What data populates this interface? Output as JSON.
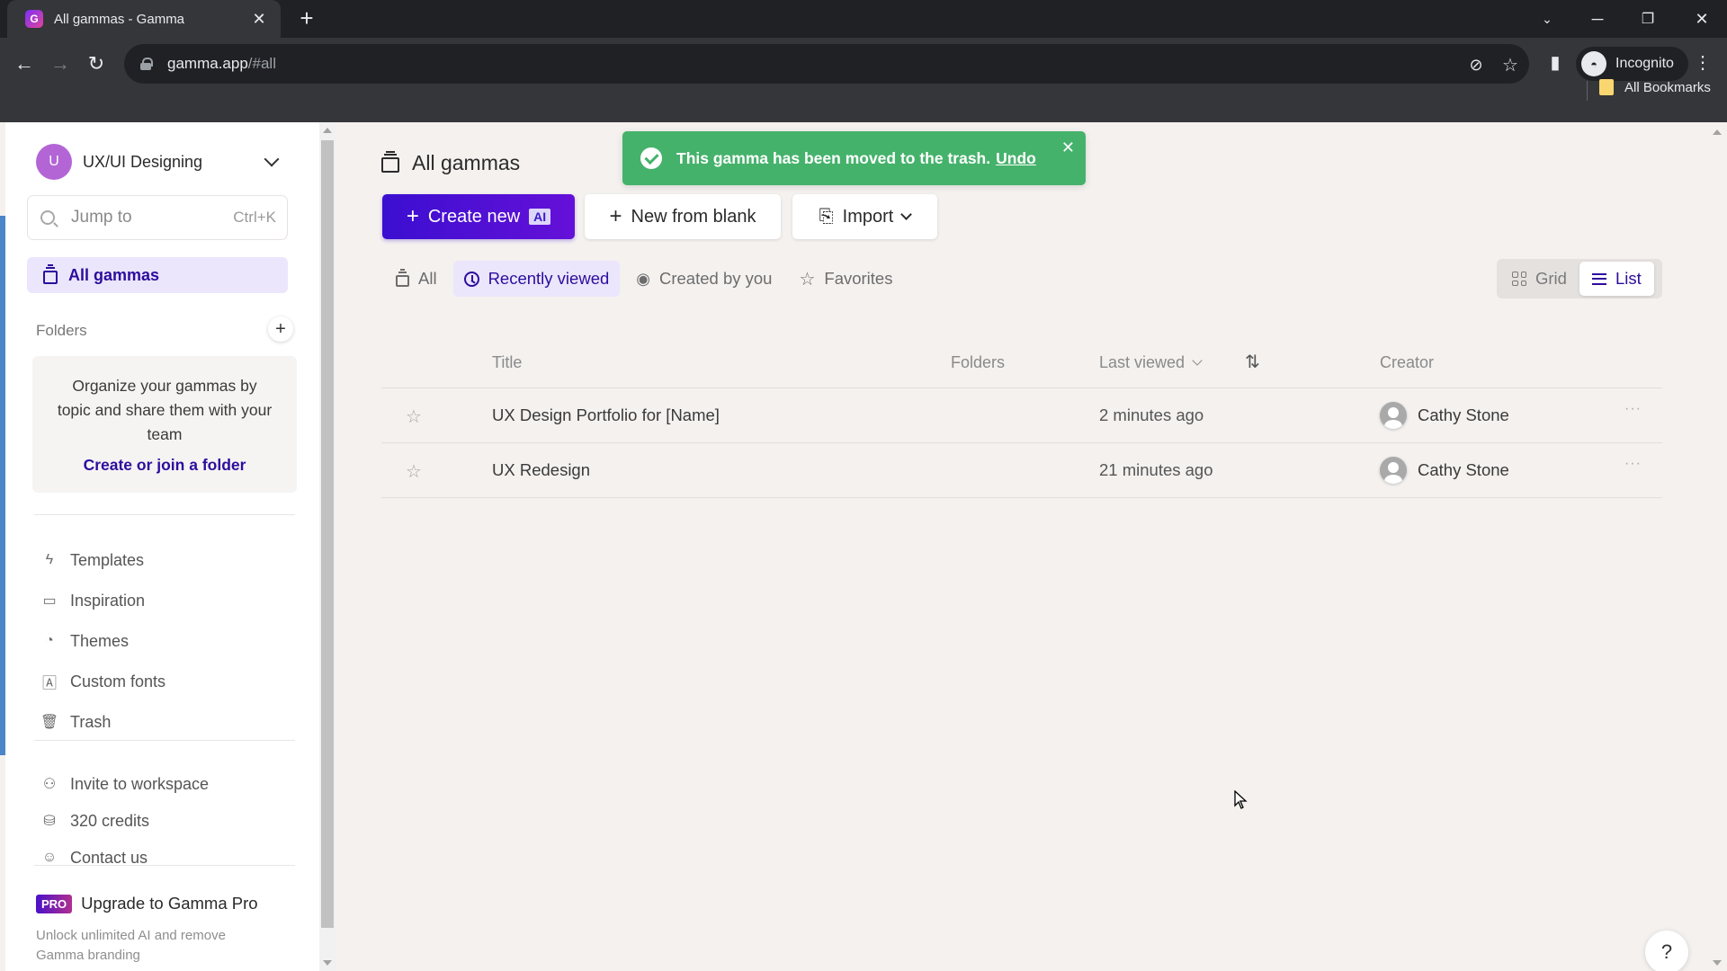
{
  "browser": {
    "tab_title": "All gammas - Gamma",
    "url_host": "gamma.app",
    "url_path": "/#all",
    "profile_label": "Incognito",
    "bookmark_label": "All Bookmarks"
  },
  "sidebar": {
    "workspace_initial": "U",
    "workspace_name": "UX/UI Designing",
    "jump_placeholder": "Jump to",
    "jump_shortcut": "Ctrl+K",
    "active_item": "All gammas",
    "folders_header": "Folders",
    "folders_description": "Organize your gammas by topic and share them with your team",
    "folders_link": "Create or join a folder",
    "nav_items": [
      {
        "label": "Templates",
        "icon": "lightning-icon"
      },
      {
        "label": "Inspiration",
        "icon": "book-icon"
      },
      {
        "label": "Themes",
        "icon": "palette-icon"
      },
      {
        "label": "Custom fonts",
        "icon": "font-icon"
      },
      {
        "label": "Trash",
        "icon": "trash-icon"
      }
    ],
    "bottom_items": [
      {
        "label": "Invite to workspace",
        "icon": "user-plus-icon"
      },
      {
        "label": "320 credits",
        "icon": "coins-icon"
      },
      {
        "label": "Contact us",
        "icon": "chat-icon"
      }
    ],
    "pro_badge": "PRO",
    "upgrade_label": "Upgrade to Gamma Pro",
    "upgrade_subtext": "Unlock unlimited AI and remove Gamma branding"
  },
  "main": {
    "title": "All gammas",
    "toast": {
      "message": "This gamma has been moved to the trash.",
      "action": "Undo",
      "color": "#45b26b"
    },
    "buttons": {
      "create": "Create new",
      "create_badge": "AI",
      "blank": "New from blank",
      "import": "Import"
    },
    "filters": [
      {
        "label": "All",
        "active": false
      },
      {
        "label": "Recently viewed",
        "active": true
      },
      {
        "label": "Created by you",
        "active": false
      },
      {
        "label": "Favorites",
        "active": false
      }
    ],
    "view_toggle": {
      "grid": "Grid",
      "list": "List",
      "selected": "List"
    },
    "table": {
      "columns": {
        "title": "Title",
        "folders": "Folders",
        "last_viewed": "Last viewed",
        "creator": "Creator"
      },
      "rows": [
        {
          "title": "UX Design Portfolio for [Name]",
          "folders": "",
          "last_viewed": "2 minutes ago",
          "creator": "Cathy Stone"
        },
        {
          "title": "UX Redesign",
          "folders": "",
          "last_viewed": "21 minutes ago",
          "creator": "Cathy Stone"
        }
      ]
    },
    "help_label": "?"
  },
  "colors": {
    "accent": "#2d0d9e",
    "create_button": "#4a10d4",
    "active_bg": "#ebe6fb"
  }
}
